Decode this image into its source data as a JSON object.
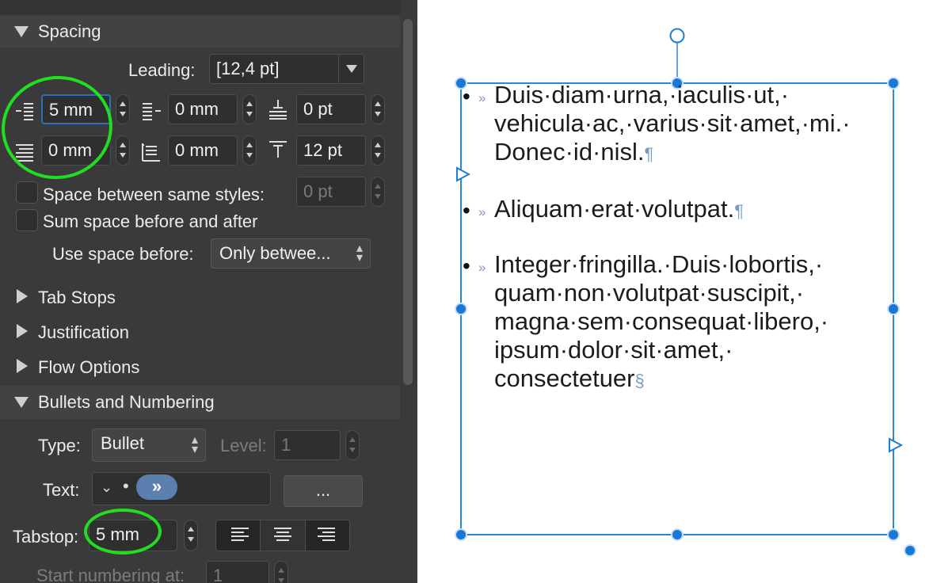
{
  "sections": {
    "spacing": "Spacing",
    "tab_stops": "Tab Stops",
    "justification": "Justification",
    "flow_options": "Flow Options",
    "bullets": "Bullets and Numbering"
  },
  "spacing": {
    "leading_label": "Leading:",
    "leading_value": "[12,4 pt]",
    "left_indent": "5 mm",
    "first_line_indent": "0 mm",
    "space_before": "0 pt",
    "first_line_left": "0 mm",
    "right_indent": "0 mm",
    "space_after": "12 pt",
    "space_same_styles_label": "Space between same styles:",
    "space_same_styles_value": "0 pt",
    "sum_space_label": "Sum space before and after",
    "use_space_before_label": "Use space before:",
    "use_space_before_value": "Only betwee..."
  },
  "bullets": {
    "type_label": "Type:",
    "type_value": "Bullet",
    "level_label": "Level:",
    "level_value": "1",
    "text_label": "Text:",
    "text_chevron": "⌄",
    "text_bullet": "•",
    "text_tab_token": "»",
    "more_button": "...",
    "tabstop_label": "Tabstop:",
    "tabstop_value": "5 mm",
    "start_numbering_label": "Start numbering at:",
    "start_numbering_value": "1"
  },
  "document": {
    "paragraphs": [
      {
        "bullet": "•",
        "tab": "»",
        "lines": [
          "Duis·diam·urna,·iaculis·ut,·",
          "vehicula·ac,·varius·sit·amet,·mi.·",
          "Donec·id·nisl."
        ],
        "end_mark": "¶"
      },
      {
        "bullet": "•",
        "tab": "»",
        "lines": [
          "Aliquam·erat·volutpat."
        ],
        "end_mark": "¶"
      },
      {
        "bullet": "•",
        "tab": "»",
        "lines": [
          "Integer·fringilla.·Duis·lobortis,·",
          "quam·non·volutpat·suscipit,·",
          "magna·sem·consequat·libero,·",
          "ipsum·dolor·sit·amet,·",
          "consectetuer"
        ],
        "end_mark": "§"
      }
    ]
  },
  "colors": {
    "panel_bg": "#3a3a3a",
    "accent_focus": "#2a6fb8",
    "highlight_circle": "#22dd22",
    "frame_blue": "#1e7fd0",
    "tab_token": "#5b7fae"
  }
}
